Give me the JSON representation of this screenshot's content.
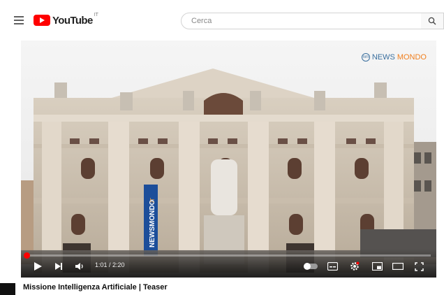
{
  "header": {
    "logo_text": "YouTube",
    "logo_region": "IT",
    "search_placeholder": "Cerca"
  },
  "video": {
    "watermark": {
      "badge": "nm",
      "part1": "NEWS",
      "part2": "MONDO"
    },
    "banner_text": "NEWSMONDO",
    "banner_suffix": "IT",
    "time_display": "1:01 / 2:20",
    "progress": 0.0
  },
  "video_title": "Missione Intelligenza Artificiale | Teaser",
  "colors": {
    "accent": "#ff0000",
    "watermark_blue": "#3a6f9e",
    "watermark_orange": "#f07f1e",
    "banner_blue": "#1c4e9a"
  },
  "icons": [
    "menu-icon",
    "search-icon",
    "play-icon",
    "next-icon",
    "volume-icon",
    "autoplay-toggle-icon",
    "subtitles-icon",
    "settings-icon",
    "miniplayer-icon",
    "theater-icon",
    "fullscreen-icon"
  ]
}
